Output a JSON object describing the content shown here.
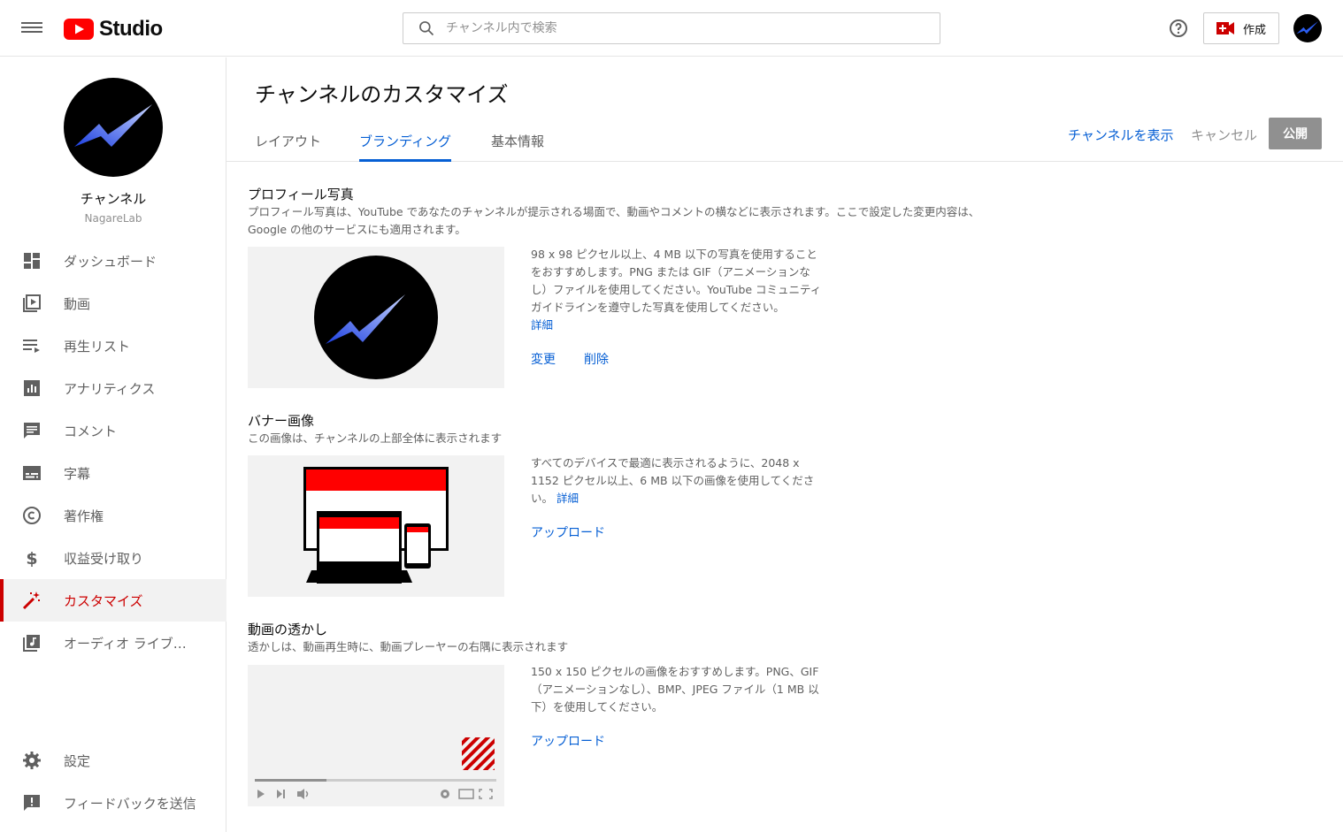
{
  "app": {
    "studio_label": "Studio"
  },
  "search": {
    "placeholder": "チャンネル内で検索"
  },
  "header": {
    "create_label": "作成"
  },
  "channel": {
    "name": "チャンネル",
    "handle": "NagareLab"
  },
  "sidebar": {
    "items": [
      {
        "label": "ダッシュボード",
        "icon": "dashboard-icon"
      },
      {
        "label": "動画",
        "icon": "video-icon"
      },
      {
        "label": "再生リスト",
        "icon": "playlist-icon"
      },
      {
        "label": "アナリティクス",
        "icon": "analytics-icon"
      },
      {
        "label": "コメント",
        "icon": "comment-icon"
      },
      {
        "label": "字幕",
        "icon": "subtitles-icon"
      },
      {
        "label": "著作権",
        "icon": "copyright-icon"
      },
      {
        "label": "収益受け取り",
        "icon": "dollar-icon"
      },
      {
        "label": "カスタマイズ",
        "icon": "magic-wand-icon",
        "active": true
      },
      {
        "label": "オーディオ ライブ…",
        "icon": "audio-library-icon"
      }
    ],
    "bottom": [
      {
        "label": "設定",
        "icon": "gear-icon"
      },
      {
        "label": "フィードバックを送信",
        "icon": "feedback-icon"
      }
    ]
  },
  "main": {
    "title": "チャンネルのカスタマイズ",
    "tabs": [
      {
        "label": "レイアウト"
      },
      {
        "label": "ブランディング",
        "active": true
      },
      {
        "label": "基本情報"
      }
    ],
    "view_channel": "チャンネルを表示",
    "cancel": "キャンセル",
    "publish": "公開"
  },
  "profile": {
    "title": "プロフィール写真",
    "desc1": "プロフィール写真は、YouTube であなたのチャンネルが提示される場面で、動画やコメントの横などに表示されます。ここで設定した変更内容は、",
    "desc2": "Google の他のサービスにも適用されます。",
    "hint": "98 x 98 ピクセル以上、4 MB 以下の写真を使用することをおすすめします。PNG または GIF（アニメーションなし）ファイルを使用してください。YouTube コミュニティ ガイドラインを遵守した写真を使用してください。",
    "detail": "詳細",
    "change": "変更",
    "delete": "削除"
  },
  "banner": {
    "title": "バナー画像",
    "desc": "この画像は、チャンネルの上部全体に表示されます",
    "hint": "すべてのデバイスで最適に表示されるように、2048 x 1152 ピクセル以上、6 MB 以下の画像を使用してください。",
    "detail": "詳細",
    "upload": "アップロード"
  },
  "watermark": {
    "title": "動画の透かし",
    "desc": "透かしは、動画再生時に、動画プレーヤーの右隅に表示されます",
    "hint": "150 x 150 ピクセルの画像をおすすめします。PNG、GIF（アニメーションなし）、BMP、JPEG ファイル（1 MB 以下）を使用してください。",
    "upload": "アップロード"
  },
  "colors": {
    "accent": "#cc0000",
    "link": "#065fd4",
    "muted": "#606060"
  }
}
